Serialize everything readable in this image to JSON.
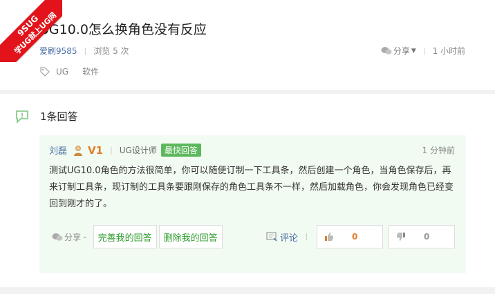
{
  "ribbon": {
    "line1": "9SUG",
    "line2": "学UG就上UG网"
  },
  "question": {
    "title": "UG10.0怎么换角色没有反应",
    "author": "爱刷9585",
    "views": "浏览 5 次",
    "share_label": "分享",
    "time": "1 小时前",
    "tags": [
      "UG",
      "软件"
    ]
  },
  "answers": {
    "count_label": "1条回答",
    "items": [
      {
        "user": "刘磊",
        "level": "V1",
        "role": "UG设计师",
        "badge": "最快回答",
        "time": "1 分钟前",
        "content": "测试UG10.0角色的方法很简单，你可以随便订制一下工具条，然后创建一个角色，当角色保存后，再来订制工具条，现订制的工具条要跟刚保存的角色工具条不一样，然后加载角色，你会发现角色已经变回到刚才的了。",
        "share_label": "分享",
        "improve_label": "完善我的回答",
        "delete_label": "删除我的回答",
        "comment_label": "评论",
        "upvotes": "0",
        "downvotes": "0"
      }
    ]
  },
  "colors": {
    "accent_green": "#2e9c2e",
    "badge_green": "#5cb85c",
    "link_blue": "#4a6fa5",
    "ribbon_red": "#e2131b",
    "card_bg": "#f2fbf2"
  },
  "icons": [
    "exclamation-bubble-icon",
    "tag-icon",
    "share-icon",
    "wechat-icon",
    "comment-icon",
    "thumbs-up-icon",
    "thumbs-down-icon",
    "avatar"
  ]
}
